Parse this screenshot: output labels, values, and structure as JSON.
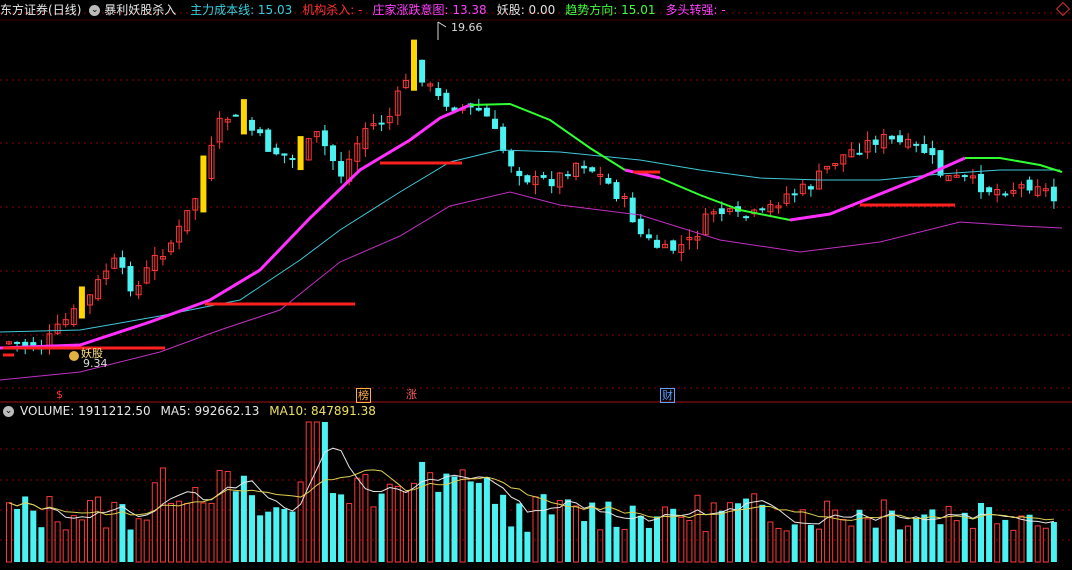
{
  "header": {
    "stock": "东方证券",
    "period": "(日线)",
    "indicator": "暴利妖股杀入",
    "items": [
      {
        "label": "主力成本线:",
        "value": "15.03",
        "color": "#35d0e0"
      },
      {
        "label": "机构杀入:",
        "value": "-",
        "color": "#ff3030"
      },
      {
        "label": "庄家涨跌意图:",
        "value": "13.38",
        "color": "#ff40ff"
      },
      {
        "label": "妖股:",
        "value": "0.00",
        "color": "#e0e0e0"
      },
      {
        "label": "趋势方向:",
        "value": "15.01",
        "color": "#40ff40"
      },
      {
        "label": "多头转强:",
        "value": "-",
        "color": "#ff40ff"
      }
    ]
  },
  "price_chart": {
    "high_label": "19.66",
    "low_label": "9.34",
    "yaoxu_label": "妖股",
    "markers": [
      {
        "text": "$",
        "color": "#ff3030"
      },
      {
        "text": "榜",
        "color": "#ffb040"
      },
      {
        "text": "涨",
        "color": "#ff6060"
      },
      {
        "text": "财",
        "color": "#60a0ff"
      }
    ]
  },
  "volume_header": {
    "volume": "VOLUME: 1911212.50",
    "ma5": "MA5: 992662.13",
    "ma10": "MA10: 847891.38"
  },
  "colors": {
    "up": "#ff3838",
    "down": "#4af2f2",
    "yellow_bar": "#ffd700",
    "cost_line": "#40c8d8",
    "trend_up": "#ff30ff",
    "trend_down": "#30ff30",
    "lower_line": "#c030c0",
    "grid": "#8b0000"
  }
}
